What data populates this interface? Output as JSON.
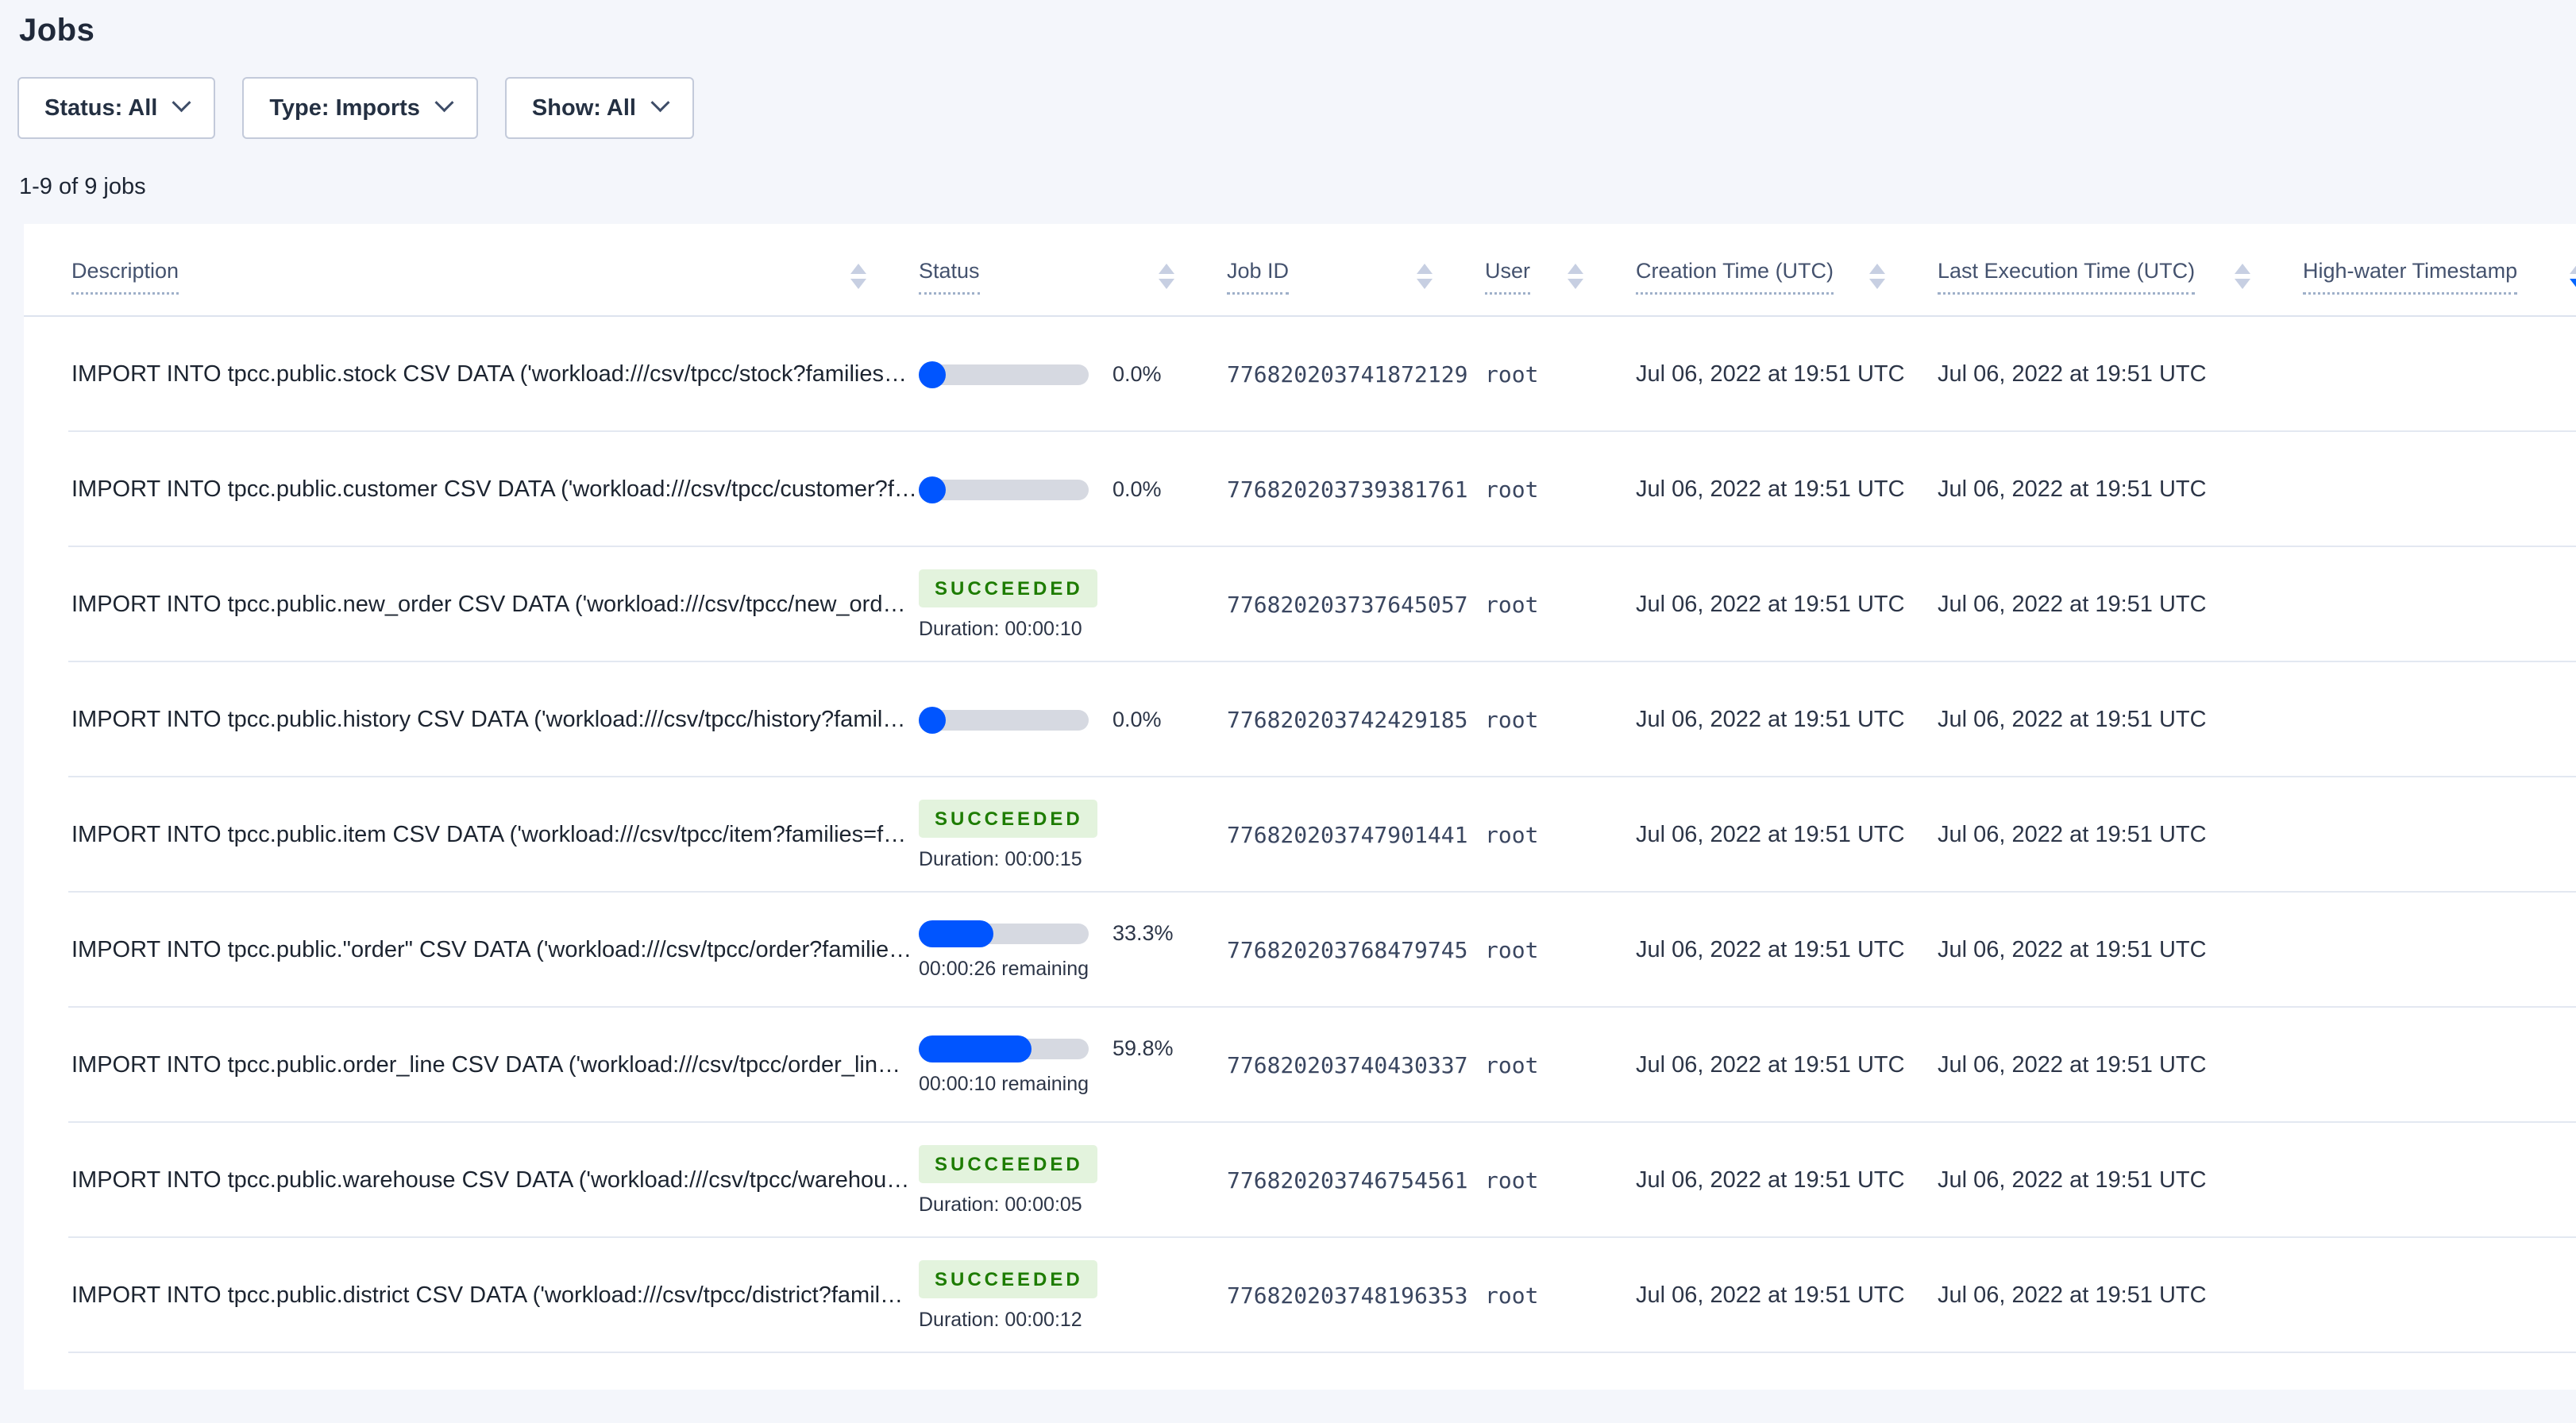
{
  "page": {
    "title": "Jobs"
  },
  "filters": [
    {
      "label": "Status: All"
    },
    {
      "label": "Type: Imports"
    },
    {
      "label": "Show: All"
    }
  ],
  "results_count": "1-9 of 9 jobs",
  "colors": {
    "accent_blue": "#0055ff",
    "progress_track": "#d6d9e1",
    "badge_bg": "#e3f3dd",
    "badge_text": "#1d7c00",
    "page_bg": "#f4f6fb",
    "sort_arrow_inactive": "#c7cfe2",
    "sort_arrow_active": "#0566ff"
  },
  "table": {
    "columns": [
      {
        "key": "description",
        "label": "Description",
        "sortable": true,
        "sorted": null
      },
      {
        "key": "status",
        "label": "Status",
        "sortable": true,
        "sorted": null
      },
      {
        "key": "job_id",
        "label": "Job ID",
        "sortable": true,
        "sorted": null
      },
      {
        "key": "user",
        "label": "User",
        "sortable": true,
        "sorted": null
      },
      {
        "key": "creation_time",
        "label": "Creation Time (UTC)",
        "sortable": true,
        "sorted": null
      },
      {
        "key": "last_execution_time",
        "label": "Last Execution Time (UTC)",
        "sortable": true,
        "sorted": null
      },
      {
        "key": "high_water",
        "label": "High-water Timestamp",
        "sortable": true,
        "sorted": "desc"
      }
    ],
    "rows": [
      {
        "description": "IMPORT INTO tpcc.public.stock CSV DATA ('workload:///csv/tpcc/stock?families…",
        "status": {
          "kind": "progress",
          "percent": 0.0,
          "label": "0.0%",
          "sub": ""
        },
        "job_id": "776820203741872129",
        "user": "root",
        "creation_time": "Jul 06, 2022 at 19:51 UTC",
        "last_execution_time": "Jul 06, 2022 at 19:51 UTC",
        "high_water": ""
      },
      {
        "description": "IMPORT INTO tpcc.public.customer CSV DATA ('workload:///csv/tpcc/customer?f…",
        "status": {
          "kind": "progress",
          "percent": 0.0,
          "label": "0.0%",
          "sub": ""
        },
        "job_id": "776820203739381761",
        "user": "root",
        "creation_time": "Jul 06, 2022 at 19:51 UTC",
        "last_execution_time": "Jul 06, 2022 at 19:51 UTC",
        "high_water": ""
      },
      {
        "description": "IMPORT INTO tpcc.public.new_order CSV DATA ('workload:///csv/tpcc/new_ord…",
        "status": {
          "kind": "badge",
          "label": "SUCCEEDED",
          "sub": "Duration: 00:00:10"
        },
        "job_id": "776820203737645057",
        "user": "root",
        "creation_time": "Jul 06, 2022 at 19:51 UTC",
        "last_execution_time": "Jul 06, 2022 at 19:51 UTC",
        "high_water": ""
      },
      {
        "description": "IMPORT INTO tpcc.public.history CSV DATA ('workload:///csv/tpcc/history?famil…",
        "status": {
          "kind": "progress",
          "percent": 0.0,
          "label": "0.0%",
          "sub": ""
        },
        "job_id": "776820203742429185",
        "user": "root",
        "creation_time": "Jul 06, 2022 at 19:51 UTC",
        "last_execution_time": "Jul 06, 2022 at 19:51 UTC",
        "high_water": ""
      },
      {
        "description": "IMPORT INTO tpcc.public.item CSV DATA ('workload:///csv/tpcc/item?families=f…",
        "status": {
          "kind": "badge",
          "label": "SUCCEEDED",
          "sub": "Duration: 00:00:15"
        },
        "job_id": "776820203747901441",
        "user": "root",
        "creation_time": "Jul 06, 2022 at 19:51 UTC",
        "last_execution_time": "Jul 06, 2022 at 19:51 UTC",
        "high_water": ""
      },
      {
        "description": "IMPORT INTO tpcc.public.\"order\" CSV DATA ('workload:///csv/tpcc/order?familie…",
        "status": {
          "kind": "progress",
          "percent": 33.3,
          "label": "33.3%",
          "sub": "00:00:26 remaining"
        },
        "job_id": "776820203768479745",
        "user": "root",
        "creation_time": "Jul 06, 2022 at 19:51 UTC",
        "last_execution_time": "Jul 06, 2022 at 19:51 UTC",
        "high_water": ""
      },
      {
        "description": "IMPORT INTO tpcc.public.order_line CSV DATA ('workload:///csv/tpcc/order_lin…",
        "status": {
          "kind": "progress",
          "percent": 59.8,
          "label": "59.8%",
          "sub": "00:00:10 remaining"
        },
        "job_id": "776820203740430337",
        "user": "root",
        "creation_time": "Jul 06, 2022 at 19:51 UTC",
        "last_execution_time": "Jul 06, 2022 at 19:51 UTC",
        "high_water": ""
      },
      {
        "description": "IMPORT INTO tpcc.public.warehouse CSV DATA ('workload:///csv/tpcc/warehou…",
        "status": {
          "kind": "badge",
          "label": "SUCCEEDED",
          "sub": "Duration: 00:00:05"
        },
        "job_id": "776820203746754561",
        "user": "root",
        "creation_time": "Jul 06, 2022 at 19:51 UTC",
        "last_execution_time": "Jul 06, 2022 at 19:51 UTC",
        "high_water": ""
      },
      {
        "description": "IMPORT INTO tpcc.public.district CSV DATA ('workload:///csv/tpcc/district?famil…",
        "status": {
          "kind": "badge",
          "label": "SUCCEEDED",
          "sub": "Duration: 00:00:12"
        },
        "job_id": "776820203748196353",
        "user": "root",
        "creation_time": "Jul 06, 2022 at 19:51 UTC",
        "last_execution_time": "Jul 06, 2022 at 19:51 UTC",
        "high_water": ""
      }
    ]
  }
}
